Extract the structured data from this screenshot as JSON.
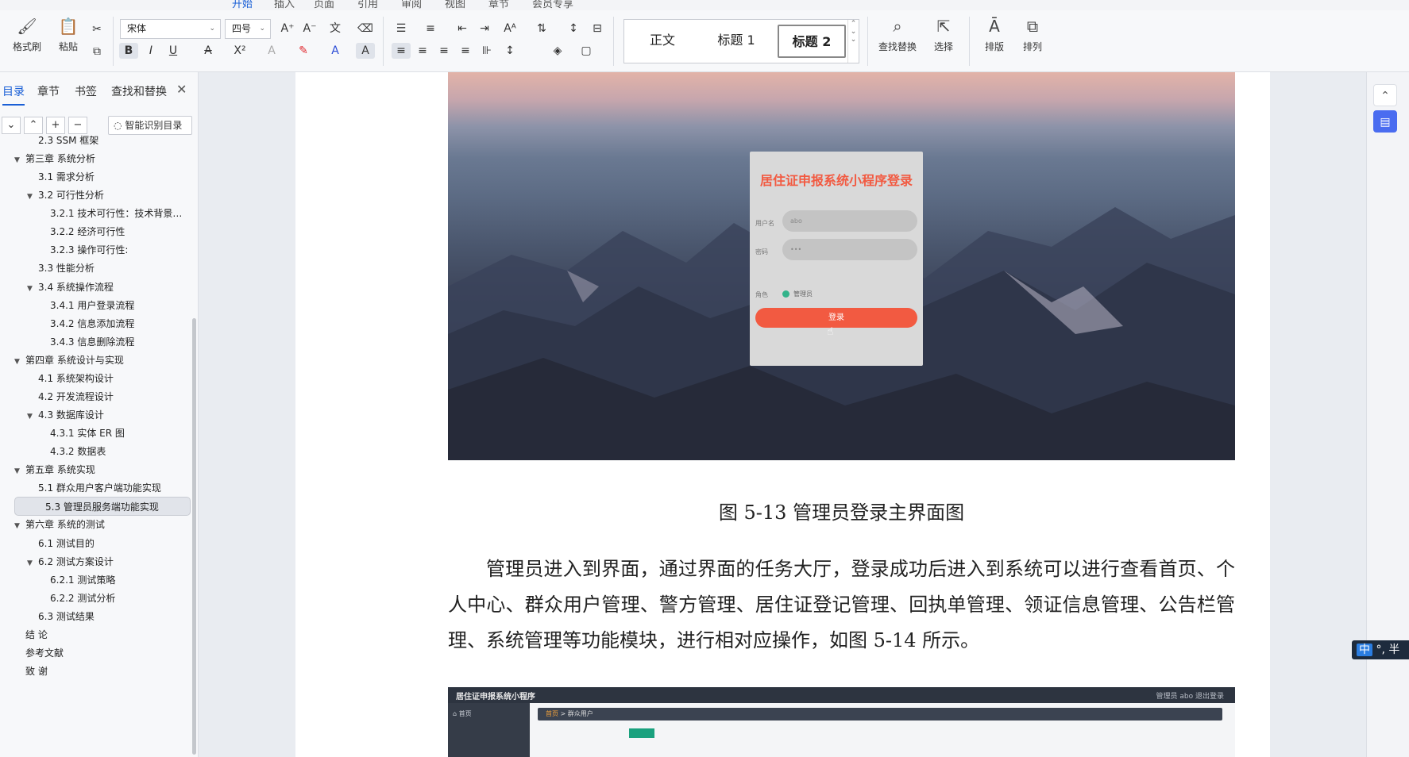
{
  "menu": {
    "items": [
      "开始",
      "插入",
      "页面",
      "引用",
      "审阅",
      "视图",
      "章节",
      "会员专享"
    ],
    "active_index": 0
  },
  "ribbon": {
    "format_painter": "格式刷",
    "paste": "粘贴",
    "font_name": "宋体",
    "font_size": "四号",
    "styles": [
      "正文",
      "标题 1",
      "标题 2"
    ],
    "current_style": "标题 2",
    "find_replace": "查找替换",
    "select": "选择",
    "layout": "排版",
    "arrange": "排列"
  },
  "nav_panel": {
    "tabs": [
      "目录",
      "章节",
      "书签",
      "查找和替换"
    ],
    "active_tab": "目录",
    "smart_toc": "智能识别目录",
    "toc": [
      {
        "label": "2.3 SSM 框架",
        "level": 2,
        "toggle": ""
      },
      {
        "label": "第三章  系统分析",
        "level": 1,
        "toggle": "▼"
      },
      {
        "label": "3.1 需求分析",
        "level": 2,
        "toggle": ""
      },
      {
        "label": "3.2 可行性分析",
        "level": 2,
        "toggle": "▼"
      },
      {
        "label": "3.2.1 技术可行性：技术背景…",
        "level": 3,
        "toggle": ""
      },
      {
        "label": "3.2.2 经济可行性",
        "level": 3,
        "toggle": ""
      },
      {
        "label": "3.2.3 操作可行性:",
        "level": 3,
        "toggle": ""
      },
      {
        "label": "3.3 性能分析",
        "level": 2,
        "toggle": ""
      },
      {
        "label": "3.4 系统操作流程",
        "level": 2,
        "toggle": "▼"
      },
      {
        "label": "3.4.1 用户登录流程",
        "level": 3,
        "toggle": ""
      },
      {
        "label": "3.4.2 信息添加流程",
        "level": 3,
        "toggle": ""
      },
      {
        "label": "3.4.3 信息删除流程",
        "level": 3,
        "toggle": ""
      },
      {
        "label": "第四章  系统设计与实现",
        "level": 1,
        "toggle": "▼"
      },
      {
        "label": "4.1 系统架构设计",
        "level": 2,
        "toggle": ""
      },
      {
        "label": "4.2 开发流程设计",
        "level": 2,
        "toggle": ""
      },
      {
        "label": "4.3 数据库设计",
        "level": 2,
        "toggle": "▼"
      },
      {
        "label": "4.3.1 实体 ER 图",
        "level": 3,
        "toggle": ""
      },
      {
        "label": "4.3.2 数据表",
        "level": 3,
        "toggle": ""
      },
      {
        "label": "第五章  系统实现",
        "level": 1,
        "toggle": "▼"
      },
      {
        "label": "5.1 群众用户客户端功能实现",
        "level": 2,
        "toggle": ""
      },
      {
        "label": "5.3 管理员服务端功能实现",
        "level": 2,
        "toggle": "",
        "selected": true
      },
      {
        "label": "第六章    系统的测试",
        "level": 1,
        "toggle": "▼"
      },
      {
        "label": "6.1  测试目的",
        "level": 2,
        "toggle": ""
      },
      {
        "label": "6.2  测试方案设计",
        "level": 2,
        "toggle": "▼"
      },
      {
        "label": "6.2.1  测试策略",
        "level": 3,
        "toggle": ""
      },
      {
        "label": "6.2.2  测试分析",
        "level": 3,
        "toggle": ""
      },
      {
        "label": "6.3  测试结果",
        "level": 2,
        "toggle": ""
      },
      {
        "label": "结   论",
        "level": 1,
        "toggle": ""
      },
      {
        "label": "参考文献",
        "level": 1,
        "toggle": ""
      },
      {
        "label": "致   谢",
        "level": 1,
        "toggle": ""
      }
    ]
  },
  "document": {
    "login_dialog": {
      "title": "居住证申报系统小程序登录",
      "username_label": "用户名",
      "username_value": "abo",
      "password_label": "密码",
      "password_value": "•••",
      "role_label": "角色",
      "role_option": "管理员",
      "login_button": "登录"
    },
    "caption": "图 5-13 管理员登录主界面图",
    "paragraph": "管理员进入到界面，通过界面的任务大厅，登录成功后进入到系统可以进行查看首页、个人中心、群众用户管理、警方管理、居住证登记管理、回执单管理、领证信息管理、公告栏管理、系统管理等功能模块，进行相对应操作，如图 5-14 所示。",
    "screenshot2": {
      "title": "居住证申报系统小程序",
      "user_info": "管理员 abo    退出登录",
      "sidebar_home": "首页",
      "crumb_home": "首页",
      "crumb_sep": ">",
      "crumb_current": "群众用户"
    }
  },
  "ime": {
    "mode": "中",
    "extra": "°, 半"
  }
}
